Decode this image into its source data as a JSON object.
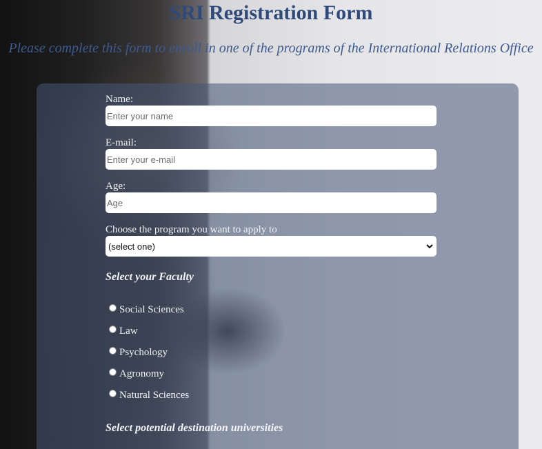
{
  "page": {
    "title": "SRI Registration Form",
    "subtitle": "Please complete this form to enroll in one of the programs of the International Relations Office"
  },
  "form": {
    "name_label": "Name:",
    "name_placeholder": "Enter your name",
    "email_label": "E-mail:",
    "email_placeholder": "Enter your e-mail",
    "age_label": "Age:",
    "age_placeholder": "Age",
    "program_label": "Choose the program you want to apply to",
    "program_selected": "(select one)",
    "faculty_title": "Select your Faculty",
    "faculties": [
      "Social Sciences",
      "Law",
      "Psychology",
      "Agronomy",
      "Natural Sciences"
    ],
    "destination_title": "Select potential destination universities"
  },
  "colors": {
    "title": "#2f4a7a",
    "subtitle": "#3d5a8f",
    "panel": "rgba(70,88,118,0.55)"
  },
  "icons": {
    "select_arrow": "chevron-down-icon"
  }
}
